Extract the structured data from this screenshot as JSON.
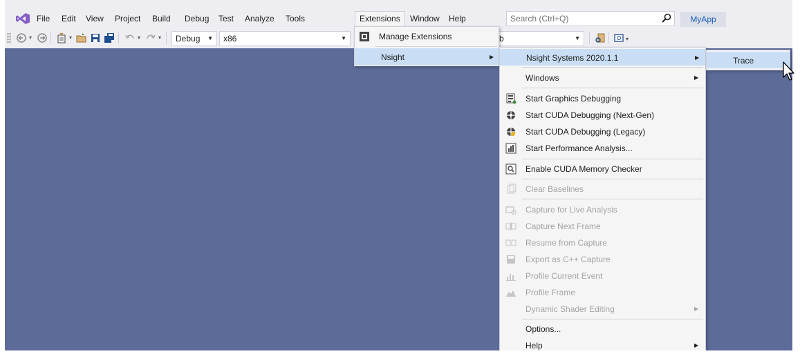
{
  "menubar": {
    "items": [
      {
        "label": "File"
      },
      {
        "label": "Edit"
      },
      {
        "label": "View"
      },
      {
        "label": "Project"
      },
      {
        "label": "Build"
      },
      {
        "label": "Debug"
      },
      {
        "label": "Test"
      },
      {
        "label": "Analyze"
      },
      {
        "label": "Tools"
      },
      {
        "label": "Extensions"
      },
      {
        "label": "Window"
      },
      {
        "label": "Help"
      }
    ],
    "search_placeholder": "Search (Ctrl+Q)",
    "app_name": "MyApp",
    "accent_color": "#1c5fb8"
  },
  "toolbar": {
    "config_value": "Debug",
    "platform_value": "x86",
    "partial_combo_text": "b"
  },
  "extensions_menu": {
    "items": [
      {
        "label": "Manage Extensions",
        "icon": "extensions-icon"
      },
      {
        "label": "Nsight",
        "has_submenu": true,
        "highlighted": true
      }
    ]
  },
  "nsight_menu": {
    "items": [
      {
        "label": "Nsight Systems 2020.1.1",
        "has_submenu": true,
        "highlighted": true
      },
      {
        "label": "Windows",
        "has_submenu": true
      },
      {
        "label": "Start Graphics Debugging",
        "icon": "graphics-debug-icon"
      },
      {
        "label": "Start CUDA Debugging (Next-Gen)",
        "icon": "cuda-next-gen-icon"
      },
      {
        "label": "Start CUDA Debugging (Legacy)",
        "icon": "cuda-legacy-icon"
      },
      {
        "label": "Start Performance Analysis...",
        "icon": "performance-analysis-icon"
      },
      {
        "label": "Enable CUDA Memory Checker",
        "icon": "memory-checker-icon"
      },
      {
        "label": "Clear Baselines",
        "icon": "clear-baselines-icon",
        "disabled": true
      },
      {
        "label": "Capture for Live Analysis",
        "icon": "live-capture-icon",
        "disabled": true
      },
      {
        "label": "Capture Next Frame",
        "icon": "capture-frame-icon",
        "disabled": true
      },
      {
        "label": "Resume from Capture",
        "icon": "resume-capture-icon",
        "disabled": true
      },
      {
        "label": "Export as C++ Capture",
        "icon": "export-icon",
        "disabled": true
      },
      {
        "label": "Profile Current Event",
        "icon": "profile-event-icon",
        "disabled": true
      },
      {
        "label": "Profile Frame",
        "icon": "profile-frame-icon",
        "disabled": true
      },
      {
        "label": "Dynamic Shader Editing",
        "has_submenu": true,
        "disabled": true
      },
      {
        "label": "Options..."
      },
      {
        "label": "Help",
        "has_submenu": true
      }
    ]
  },
  "nsight_systems_menu": {
    "items": [
      {
        "label": "Trace",
        "highlighted": true
      }
    ]
  },
  "colors": {
    "editor_background": "#5d6b99",
    "menu_highlight": "#c9def5",
    "chrome_background": "#eeeef2",
    "disabled_text": "#a2a4a5"
  }
}
